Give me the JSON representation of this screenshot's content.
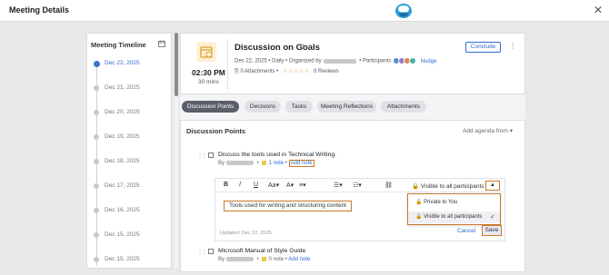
{
  "header": {
    "title": "Meeting Details",
    "close_label": "✕",
    "logo_icon": "app-logo-icon"
  },
  "timeline": {
    "title": "Meeting Timeline",
    "items": [
      {
        "label": "Dec 22, 2025",
        "active": true
      },
      {
        "label": "Dec 21, 2025",
        "active": false
      },
      {
        "label": "Dec 20, 2025",
        "active": false
      },
      {
        "label": "Dec 19, 2025",
        "active": false
      },
      {
        "label": "Dec 18, 2025",
        "active": false
      },
      {
        "label": "Dec 17, 2025",
        "active": false
      },
      {
        "label": "Dec 16, 2025",
        "active": false
      },
      {
        "label": "Dec 15, 2025",
        "active": false
      },
      {
        "label": "Dec 15, 2025",
        "active": false
      }
    ]
  },
  "meeting": {
    "time": "02:30 PM",
    "duration": "30 mins",
    "title": "Discussion on Goals",
    "date": "Dec 22, 2025",
    "frequency": "Daily",
    "organized_by_label": "Organized by",
    "participants_label": "Participants",
    "nudge_label": "Nudge",
    "attachments_label": "0 Attachments",
    "reviews_label": "0 Reviews",
    "stars": "☆☆☆☆☆",
    "conclude_label": "Conclude",
    "rating_value": 0
  },
  "tabs": [
    {
      "label": "Discussion Points",
      "active": true
    },
    {
      "label": "Decisions",
      "active": false
    },
    {
      "label": "Tasks",
      "active": false
    },
    {
      "label": "Meeting Reflections",
      "active": false
    },
    {
      "label": "Attachments",
      "active": false
    }
  ],
  "discussion": {
    "title": "Discussion Points",
    "add_agenda_label": "Add agenda from",
    "items": [
      {
        "title": "Discuss the tools used in Technical Writing.",
        "by_label": "By",
        "notes_label": "1 note",
        "add_note_label": "Add note"
      },
      {
        "title": "Microsoft Manual of Style Guide",
        "by_label": "By",
        "notes_label": "0 note",
        "add_note_label": "Add note"
      }
    ]
  },
  "editor": {
    "toolbar": [
      "B",
      "I",
      "U",
      "A",
      "A",
      "≡",
      "☰",
      "☷",
      "⛓"
    ],
    "visibility_label": "Visible to all participants",
    "note_text": "Tools used for writing and structuring content",
    "updated_label": "Updated: Dec 22, 2025",
    "cancel_label": "Cancel",
    "save_label": "Save"
  },
  "visibility_menu": {
    "options": [
      {
        "label": "Private to You",
        "selected": false
      },
      {
        "label": "Visible to all participants",
        "selected": true
      }
    ],
    "check": "✓"
  },
  "colors": {
    "accent": "#2f6ad1",
    "highlight": "#c8782a",
    "active_tab": "#5b5f6b"
  }
}
